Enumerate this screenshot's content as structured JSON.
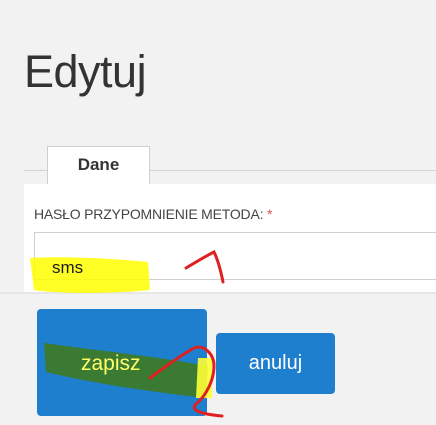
{
  "page": {
    "title": "Edytuj"
  },
  "tabs": [
    {
      "label": "Dane"
    }
  ],
  "form": {
    "field_label": "HASŁO PRZYPOMNIENIE METODA:",
    "required_mark": "*",
    "field_value": "sms"
  },
  "buttons": {
    "save_label": "zapisz",
    "cancel_label": "anuluj"
  },
  "colors": {
    "accent": "#1e7fce",
    "highlight": "#ffff00",
    "annotation": "#e02020"
  }
}
